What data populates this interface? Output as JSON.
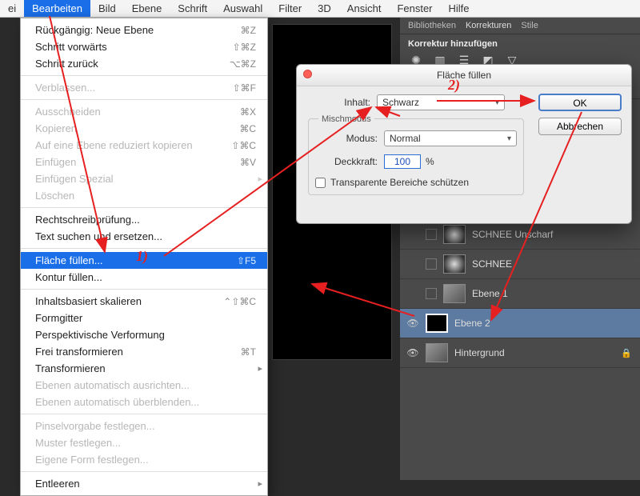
{
  "menubar": {
    "items": [
      "ei",
      "Bearbeiten",
      "Bild",
      "Ebene",
      "Schrift",
      "Auswahl",
      "Filter",
      "3D",
      "Ansicht",
      "Fenster",
      "Hilfe"
    ],
    "active_index": 1
  },
  "dropdown": {
    "items": [
      {
        "label": "Rückgängig: Neue Ebene",
        "sc": "⌘Z"
      },
      {
        "label": "Schritt vorwärts",
        "sc": "⇧⌘Z"
      },
      {
        "label": "Schritt zurück",
        "sc": "⌥⌘Z"
      },
      {
        "sep": true
      },
      {
        "label": "Verblassen...",
        "sc": "⇧⌘F",
        "disabled": true
      },
      {
        "sep": true
      },
      {
        "label": "Ausschneiden",
        "sc": "⌘X",
        "disabled": true
      },
      {
        "label": "Kopieren",
        "sc": "⌘C",
        "disabled": true
      },
      {
        "label": "Auf eine Ebene reduziert kopieren",
        "sc": "⇧⌘C",
        "disabled": true
      },
      {
        "label": "Einfügen",
        "sc": "⌘V",
        "disabled": true
      },
      {
        "label": "Einfügen Spezial",
        "sub": true,
        "disabled": true
      },
      {
        "label": "Löschen",
        "disabled": true
      },
      {
        "sep": true
      },
      {
        "label": "Rechtschreibprüfung..."
      },
      {
        "label": "Text suchen und ersetzen..."
      },
      {
        "sep": true
      },
      {
        "label": "Fläche füllen...",
        "sc": "⇧F5",
        "selected": true
      },
      {
        "label": "Kontur füllen..."
      },
      {
        "sep": true
      },
      {
        "label": "Inhaltsbasiert skalieren",
        "sc": "⌃⇧⌘C"
      },
      {
        "label": "Formgitter"
      },
      {
        "label": "Perspektivische Verformung"
      },
      {
        "label": "Frei transformieren",
        "sc": "⌘T"
      },
      {
        "label": "Transformieren",
        "sub": true
      },
      {
        "label": "Ebenen automatisch ausrichten...",
        "disabled": true
      },
      {
        "label": "Ebenen automatisch überblenden...",
        "disabled": true
      },
      {
        "sep": true
      },
      {
        "label": "Pinselvorgabe festlegen...",
        "disabled": true
      },
      {
        "label": "Muster festlegen...",
        "disabled": true
      },
      {
        "label": "Eigene Form festlegen...",
        "disabled": true
      },
      {
        "sep": true
      },
      {
        "label": "Entleeren",
        "sub": true
      }
    ]
  },
  "adjust_panel": {
    "tab1": "Bibliotheken",
    "tab2": "Korrekturen",
    "tab3": "Stile",
    "title": "Korrektur hinzufügen"
  },
  "layers": {
    "items": [
      {
        "name": "SCHNEE Unscharf",
        "visible": false,
        "thumb": "blur",
        "check": true
      },
      {
        "name": "SCHNEE",
        "visible": false,
        "thumb": "blur",
        "check": true
      },
      {
        "name": "Ebene 1",
        "visible": false,
        "thumb": "gray",
        "check": true
      },
      {
        "name": "Ebene 2",
        "visible": true,
        "thumb": "black",
        "selected": true
      },
      {
        "name": "Hintergrund",
        "visible": true,
        "thumb": "gray",
        "locked": true
      }
    ]
  },
  "dialog": {
    "title": "Fläche füllen",
    "content_label": "Inhalt:",
    "content_value": "Schwarz",
    "blend_legend": "Mischmodus",
    "mode_label": "Modus:",
    "mode_value": "Normal",
    "opacity_label": "Deckkraft:",
    "opacity_value": "100",
    "opacity_pct": "%",
    "preserve_label": "Transparente Bereiche schützen",
    "ok": "OK",
    "cancel": "Abbrechen"
  },
  "annotations": {
    "one": "1)",
    "two": "2)"
  }
}
